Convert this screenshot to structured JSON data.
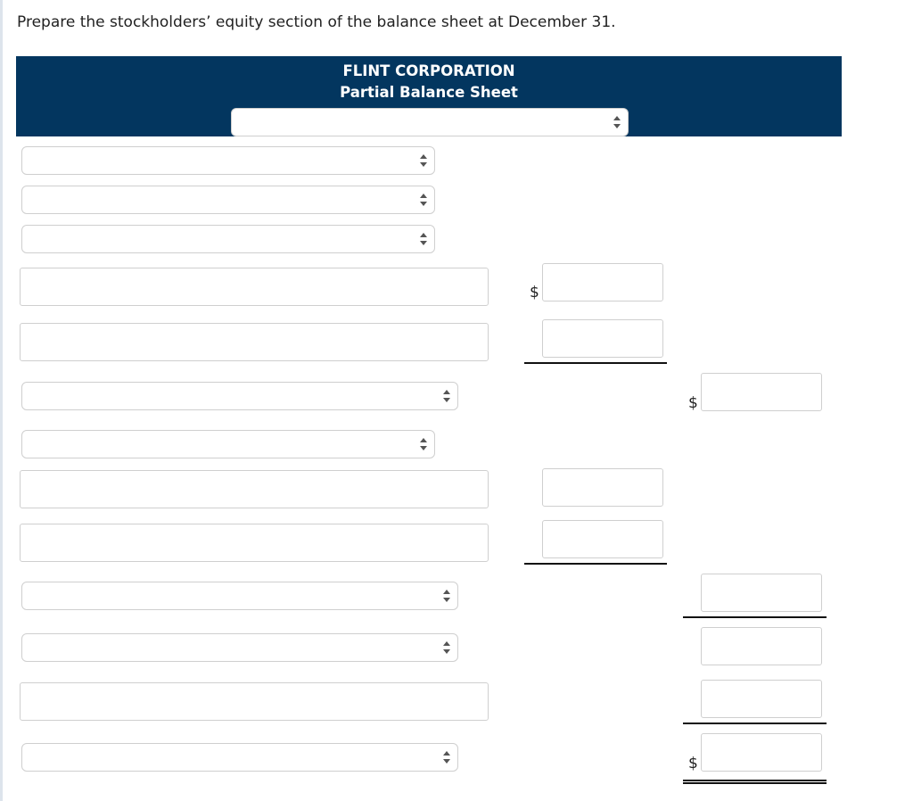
{
  "prompt": "Prepare the stockholders’ equity section of the balance sheet at December 31.",
  "header": {
    "company": "FLINT CORPORATION",
    "statement": "Partial Balance Sheet",
    "date_select": {
      "value": ""
    }
  },
  "currency_symbol": "$",
  "rows": [
    {
      "type": "select",
      "value": ""
    },
    {
      "type": "select",
      "value": ""
    },
    {
      "type": "select",
      "value": ""
    },
    {
      "type": "text",
      "value": "",
      "col1": "",
      "col1_dollar": true
    },
    {
      "type": "text",
      "value": "",
      "col1": ""
    },
    {
      "type": "select",
      "value": "",
      "col2": "",
      "col2_dollar": true
    },
    {
      "type": "select",
      "value": ""
    },
    {
      "type": "text",
      "value": "",
      "col1": ""
    },
    {
      "type": "text",
      "value": "",
      "col1": ""
    },
    {
      "type": "select",
      "value": "",
      "col2": ""
    },
    {
      "type": "select",
      "value": "",
      "col2": ""
    },
    {
      "type": "text",
      "value": "",
      "col2": ""
    },
    {
      "type": "select",
      "value": "",
      "col2": "",
      "col2_dollar": true
    }
  ]
}
